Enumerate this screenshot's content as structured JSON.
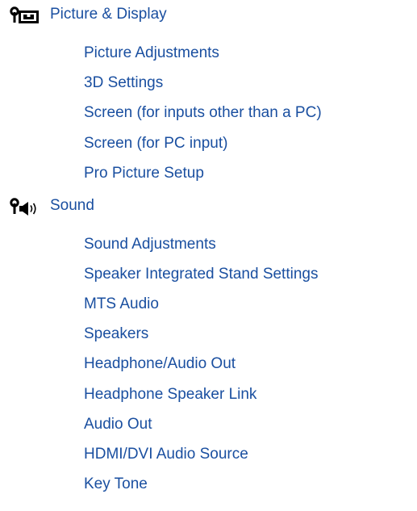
{
  "sections": [
    {
      "icon": "picture-display-icon",
      "title": "Picture & Display",
      "items": [
        "Picture Adjustments",
        "3D Settings",
        "Screen (for inputs other than a PC)",
        "Screen (for PC input)",
        "Pro Picture Setup"
      ]
    },
    {
      "icon": "sound-icon",
      "title": "Sound",
      "items": [
        "Sound Adjustments",
        "Speaker Integrated Stand Settings",
        "MTS Audio",
        "Speakers",
        "Headphone/Audio Out",
        "Headphone Speaker Link",
        "Audio Out",
        "HDMI/DVI Audio Source",
        "Key Tone"
      ]
    }
  ],
  "colors": {
    "link": "#1a4fa0",
    "icon": "#000000"
  }
}
